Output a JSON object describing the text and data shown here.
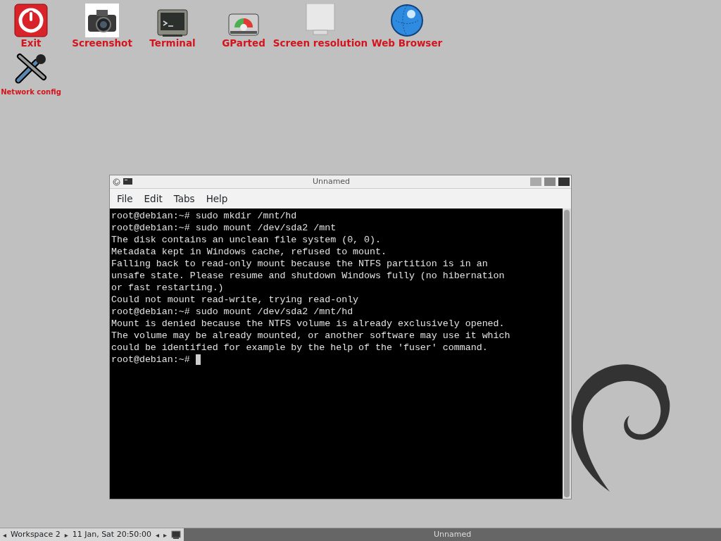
{
  "desktop_icons": [
    {
      "label": "Exit"
    },
    {
      "label": "Screenshot"
    },
    {
      "label": "Terminal"
    },
    {
      "label": "GParted"
    },
    {
      "label": "Screen resolution"
    },
    {
      "label": "Web Browser"
    },
    {
      "label": "Network config"
    }
  ],
  "window": {
    "title": "Unnamed",
    "menu": [
      "File",
      "Edit",
      "Tabs",
      "Help"
    ],
    "lines": [
      "root@debian:~# sudo mkdir /mnt/hd",
      "root@debian:~# sudo mount /dev/sda2 /mnt",
      "The disk contains an unclean file system (0, 0).",
      "Metadata kept in Windows cache, refused to mount.",
      "Falling back to read-only mount because the NTFS partition is in an",
      "unsafe state. Please resume and shutdown Windows fully (no hibernation",
      "or fast restarting.)",
      "Could not mount read-write, trying read-only",
      "root@debian:~# sudo mount /dev/sda2 /mnt/hd",
      "Mount is denied because the NTFS volume is already exclusively opened.",
      "The volume may be already mounted, or another software may use it which",
      "could be identified for example by the help of the 'fuser' command.",
      "root@debian:~# "
    ]
  },
  "taskbar": {
    "workspace_prev": "◂",
    "workspace": "Workspace 2",
    "workspace_next": "▸",
    "clock": "11 Jan, Sat 20:50:00",
    "nav_prev": "◂",
    "nav_next": "▸",
    "tasks": [
      {
        "title": "Unnamed",
        "selected": true
      }
    ]
  }
}
